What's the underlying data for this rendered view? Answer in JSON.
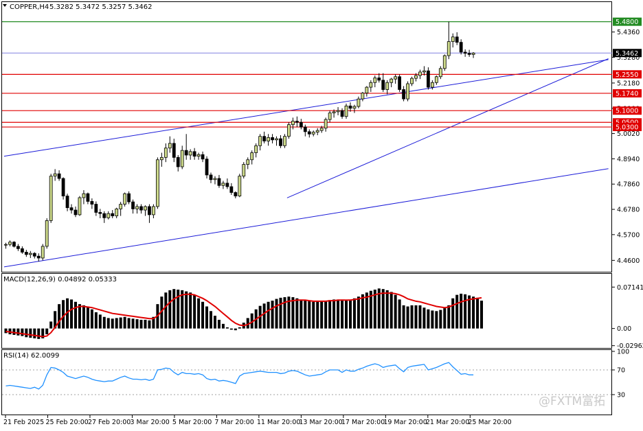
{
  "header": {
    "symbol_label": "COPPER,H4",
    "ohlc_text": "5.3282 5.3472 5.3257 5.3462",
    "menu_triangle": "triangle-down-icon"
  },
  "macd_panel": {
    "label": "MACD(12,26,9) 0.04892 0.05333",
    "scale": [
      "0.07141",
      "0.00",
      "-0.02962"
    ]
  },
  "rsi_panel": {
    "label": "RSI(14) 62.0099",
    "scale": [
      "100",
      "70",
      "30"
    ]
  },
  "watermark": "@FXTM富拓",
  "colors": {
    "bull_candle": "#ccd98a",
    "bear_candle": "#000000",
    "macd_histogram": "#000000",
    "macd_signal": "#e00000",
    "rsi_line": "#1e90ff",
    "support_resistance": "#e00000",
    "high_line": "#228b22",
    "trend_channel": "#1a1ad8",
    "current_price_line": "#8080e0"
  },
  "chart_data": {
    "type": "candlestick",
    "symbol": "COPPER",
    "timeframe": "H4",
    "ylim": [
      4.42,
      5.52
    ],
    "y_ticks": [
      "5.4360",
      "5.3280",
      "5.2180",
      "5.1100",
      "5.0020",
      "4.8940",
      "4.7860",
      "4.6780",
      "4.5700",
      "4.4600"
    ],
    "x_tick_labels": [
      "21 Feb 2025",
      "25 Feb 20:00",
      "27 Feb 20:00",
      "3 Mar 20:00",
      "5 Mar 20:00",
      "7 Mar 20:00",
      "11 Mar 20:00",
      "13 Mar 20:00",
      "17 Mar 20:00",
      "19 Mar 20:00",
      "21 Mar 20:00",
      "25 Mar 20:00"
    ],
    "horizontal_levels": [
      {
        "label": "5.4800",
        "value": 5.48,
        "kind": "high"
      },
      {
        "label": "5.2550",
        "value": 5.255,
        "kind": "level"
      },
      {
        "label": "5.1740",
        "value": 5.174,
        "kind": "level"
      },
      {
        "label": "5.1000",
        "value": 5.1,
        "kind": "level"
      },
      {
        "label": "5.0500",
        "value": 5.05,
        "kind": "level"
      },
      {
        "label": "5.0300",
        "value": 5.03,
        "kind": "level"
      }
    ],
    "current_price": {
      "label": "5.3462",
      "value": 5.3462
    },
    "trendlines": [
      {
        "from": [
          0,
          4.905
        ],
        "to": [
          147,
          5.318
        ]
      },
      {
        "from": [
          0,
          4.432
        ],
        "to": [
          147,
          4.852
        ]
      },
      {
        "from": [
          69,
          4.727
        ],
        "to": [
          147,
          5.322
        ]
      }
    ],
    "candles": [
      [
        4.525,
        4.535,
        4.51,
        4.528
      ],
      [
        4.528,
        4.545,
        4.52,
        4.538
      ],
      [
        4.538,
        4.542,
        4.515,
        4.52
      ],
      [
        4.52,
        4.53,
        4.5,
        4.51
      ],
      [
        4.51,
        4.52,
        4.488,
        4.495
      ],
      [
        4.495,
        4.505,
        4.475,
        4.485
      ],
      [
        4.485,
        4.5,
        4.47,
        4.49
      ],
      [
        4.49,
        4.495,
        4.468,
        4.478
      ],
      [
        4.478,
        4.49,
        4.455,
        4.47
      ],
      [
        4.47,
        4.53,
        4.46,
        4.52
      ],
      [
        4.52,
        4.64,
        4.51,
        4.63
      ],
      [
        4.63,
        4.83,
        4.62,
        4.82
      ],
      [
        4.82,
        4.85,
        4.8,
        4.83
      ],
      [
        4.83,
        4.845,
        4.8,
        4.81
      ],
      [
        4.81,
        4.815,
        4.72,
        4.735
      ],
      [
        4.735,
        4.745,
        4.67,
        4.685
      ],
      [
        4.685,
        4.7,
        4.66,
        4.675
      ],
      [
        4.675,
        4.69,
        4.645,
        4.655
      ],
      [
        4.655,
        4.735,
        4.65,
        4.728
      ],
      [
        4.728,
        4.76,
        4.7,
        4.745
      ],
      [
        4.745,
        4.75,
        4.7,
        4.712
      ],
      [
        4.712,
        4.725,
        4.68,
        4.7
      ],
      [
        4.7,
        4.712,
        4.65,
        4.665
      ],
      [
        4.665,
        4.68,
        4.64,
        4.66
      ],
      [
        4.66,
        4.67,
        4.62,
        4.642
      ],
      [
        4.642,
        4.67,
        4.635,
        4.66
      ],
      [
        4.66,
        4.675,
        4.64,
        4.65
      ],
      [
        4.65,
        4.685,
        4.64,
        4.68
      ],
      [
        4.68,
        4.71,
        4.65,
        4.7
      ],
      [
        4.7,
        4.75,
        4.69,
        4.745
      ],
      [
        4.745,
        4.755,
        4.7,
        4.71
      ],
      [
        4.71,
        4.72,
        4.66,
        4.68
      ],
      [
        4.68,
        4.7,
        4.66,
        4.69
      ],
      [
        4.69,
        4.7,
        4.66,
        4.675
      ],
      [
        4.675,
        4.695,
        4.65,
        4.69
      ],
      [
        4.69,
        4.7,
        4.62,
        4.655
      ],
      [
        4.655,
        4.7,
        4.64,
        4.69
      ],
      [
        4.69,
        4.9,
        4.68,
        4.89
      ],
      [
        4.89,
        4.92,
        4.86,
        4.9
      ],
      [
        4.9,
        4.96,
        4.88,
        4.94
      ],
      [
        4.94,
        4.99,
        4.92,
        4.96
      ],
      [
        4.96,
        4.98,
        4.88,
        4.9
      ],
      [
        4.9,
        4.91,
        4.84,
        4.86
      ],
      [
        4.86,
        4.95,
        4.85,
        4.93
      ],
      [
        4.93,
        5.0,
        4.89,
        4.91
      ],
      [
        4.91,
        4.935,
        4.89,
        4.925
      ],
      [
        4.925,
        4.94,
        4.89,
        4.905
      ],
      [
        4.905,
        4.92,
        4.89,
        4.912
      ],
      [
        4.912,
        4.925,
        4.88,
        4.893
      ],
      [
        4.893,
        4.905,
        4.81,
        4.825
      ],
      [
        4.825,
        4.835,
        4.79,
        4.805
      ],
      [
        4.805,
        4.82,
        4.785,
        4.81
      ],
      [
        4.81,
        4.825,
        4.77,
        4.78
      ],
      [
        4.78,
        4.8,
        4.765,
        4.79
      ],
      [
        4.79,
        4.81,
        4.765,
        4.775
      ],
      [
        4.775,
        4.79,
        4.74,
        4.75
      ],
      [
        4.75,
        4.755,
        4.725,
        4.735
      ],
      [
        4.735,
        4.83,
        4.73,
        4.82
      ],
      [
        4.82,
        4.88,
        4.81,
        4.87
      ],
      [
        4.87,
        4.9,
        4.85,
        4.89
      ],
      [
        4.89,
        4.93,
        4.87,
        4.92
      ],
      [
        4.92,
        4.96,
        4.9,
        4.95
      ],
      [
        4.95,
        5.0,
        4.93,
        4.99
      ],
      [
        4.99,
        5.01,
        4.96,
        4.97
      ],
      [
        4.97,
        5.0,
        4.95,
        4.985
      ],
      [
        4.985,
        5.0,
        4.96,
        4.975
      ],
      [
        4.975,
        4.99,
        4.95,
        4.98
      ],
      [
        4.98,
        4.995,
        4.94,
        4.95
      ],
      [
        4.95,
        5.0,
        4.94,
        4.99
      ],
      [
        4.99,
        5.05,
        4.98,
        5.04
      ],
      [
        5.04,
        5.07,
        5.02,
        5.055
      ],
      [
        5.055,
        5.075,
        5.03,
        5.05
      ],
      [
        5.05,
        5.065,
        5.02,
        5.03
      ],
      [
        5.03,
        5.04,
        4.99,
        5.01
      ],
      [
        5.01,
        5.02,
        4.985,
        5.0
      ],
      [
        5.0,
        5.015,
        4.99,
        5.008
      ],
      [
        5.008,
        5.025,
        4.995,
        5.015
      ],
      [
        5.015,
        5.035,
        5.005,
        5.025
      ],
      [
        5.025,
        5.07,
        5.01,
        5.062
      ],
      [
        5.062,
        5.1,
        5.05,
        5.09
      ],
      [
        5.09,
        5.105,
        5.07,
        5.095
      ],
      [
        5.095,
        5.115,
        5.08,
        5.1
      ],
      [
        5.1,
        5.11,
        5.065,
        5.075
      ],
      [
        5.075,
        5.13,
        5.065,
        5.12
      ],
      [
        5.12,
        5.135,
        5.095,
        5.11
      ],
      [
        5.11,
        5.125,
        5.09,
        5.118
      ],
      [
        5.118,
        5.16,
        5.11,
        5.15
      ],
      [
        5.15,
        5.18,
        5.14,
        5.175
      ],
      [
        5.175,
        5.205,
        5.16,
        5.2
      ],
      [
        5.2,
        5.23,
        5.18,
        5.22
      ],
      [
        5.22,
        5.25,
        5.2,
        5.24
      ],
      [
        5.24,
        5.26,
        5.22,
        5.23
      ],
      [
        5.23,
        5.26,
        5.18,
        5.19
      ],
      [
        5.19,
        5.23,
        5.17,
        5.22
      ],
      [
        5.22,
        5.24,
        5.2,
        5.235
      ],
      [
        5.235,
        5.255,
        5.215,
        5.245
      ],
      [
        5.245,
        5.255,
        5.18,
        5.19
      ],
      [
        5.19,
        5.205,
        5.14,
        5.15
      ],
      [
        5.15,
        5.225,
        5.14,
        5.215
      ],
      [
        5.215,
        5.245,
        5.205,
        5.238
      ],
      [
        5.238,
        5.26,
        5.225,
        5.25
      ],
      [
        5.25,
        5.275,
        5.235,
        5.265
      ],
      [
        5.265,
        5.29,
        5.25,
        5.27
      ],
      [
        5.27,
        5.285,
        5.19,
        5.2
      ],
      [
        5.2,
        5.23,
        5.19,
        5.22
      ],
      [
        5.22,
        5.25,
        5.21,
        5.245
      ],
      [
        5.245,
        5.29,
        5.235,
        5.28
      ],
      [
        5.28,
        5.34,
        5.27,
        5.335
      ],
      [
        5.335,
        5.48,
        5.32,
        5.395
      ],
      [
        5.395,
        5.43,
        5.37,
        5.415
      ],
      [
        5.415,
        5.435,
        5.38,
        5.392
      ],
      [
        5.392,
        5.405,
        5.34,
        5.35
      ],
      [
        5.35,
        5.362,
        5.33,
        5.345
      ],
      [
        5.345,
        5.36,
        5.33,
        5.34
      ],
      [
        5.34,
        5.35,
        5.325,
        5.346
      ]
    ],
    "macd_ylim": [
      -0.03,
      0.0765
    ],
    "macd_histogram": [
      -0.008,
      -0.01,
      -0.011,
      -0.012,
      -0.013,
      -0.015,
      -0.016,
      -0.017,
      -0.018,
      -0.017,
      -0.01,
      0.012,
      0.03,
      0.042,
      0.049,
      0.052,
      0.05,
      0.046,
      0.042,
      0.04,
      0.038,
      0.033,
      0.028,
      0.024,
      0.02,
      0.018,
      0.017,
      0.018,
      0.019,
      0.02,
      0.018,
      0.017,
      0.016,
      0.015,
      0.015,
      0.014,
      0.02,
      0.042,
      0.055,
      0.062,
      0.066,
      0.068,
      0.067,
      0.066,
      0.064,
      0.062,
      0.058,
      0.052,
      0.046,
      0.038,
      0.03,
      0.022,
      0.015,
      0.008,
      0.002,
      -0.002,
      -0.003,
      0.002,
      0.01,
      0.018,
      0.026,
      0.033,
      0.039,
      0.043,
      0.046,
      0.048,
      0.051,
      0.053,
      0.054,
      0.055,
      0.054,
      0.052,
      0.05,
      0.048,
      0.047,
      0.046,
      0.046,
      0.047,
      0.048,
      0.049,
      0.05,
      0.05,
      0.05,
      0.049,
      0.05,
      0.052,
      0.055,
      0.059,
      0.062,
      0.065,
      0.067,
      0.069,
      0.068,
      0.066,
      0.063,
      0.058,
      0.05,
      0.04,
      0.038,
      0.04,
      0.04,
      0.04,
      0.036,
      0.033,
      0.031,
      0.03,
      0.032,
      0.035,
      0.04,
      0.052,
      0.058,
      0.06,
      0.059,
      0.057,
      0.055,
      0.053,
      0.048
    ],
    "macd_signal": [
      -0.005,
      -0.006,
      -0.007,
      -0.008,
      -0.009,
      -0.01,
      -0.011,
      -0.012,
      -0.013,
      -0.014,
      -0.013,
      -0.007,
      0.002,
      0.012,
      0.021,
      0.028,
      0.033,
      0.036,
      0.038,
      0.038,
      0.037,
      0.036,
      0.034,
      0.032,
      0.03,
      0.028,
      0.026,
      0.025,
      0.024,
      0.023,
      0.022,
      0.021,
      0.02,
      0.019,
      0.018,
      0.017,
      0.017,
      0.022,
      0.03,
      0.038,
      0.045,
      0.051,
      0.055,
      0.058,
      0.059,
      0.059,
      0.058,
      0.055,
      0.052,
      0.048,
      0.043,
      0.038,
      0.032,
      0.026,
      0.02,
      0.014,
      0.009,
      0.006,
      0.005,
      0.007,
      0.011,
      0.016,
      0.021,
      0.026,
      0.031,
      0.035,
      0.039,
      0.042,
      0.045,
      0.047,
      0.048,
      0.049,
      0.049,
      0.049,
      0.048,
      0.047,
      0.047,
      0.047,
      0.047,
      0.048,
      0.048,
      0.049,
      0.049,
      0.049,
      0.049,
      0.05,
      0.051,
      0.053,
      0.054,
      0.056,
      0.058,
      0.06,
      0.061,
      0.061,
      0.061,
      0.06,
      0.058,
      0.055,
      0.051,
      0.049,
      0.047,
      0.046,
      0.044,
      0.042,
      0.04,
      0.038,
      0.037,
      0.036,
      0.037,
      0.04,
      0.043,
      0.046,
      0.048,
      0.05,
      0.051,
      0.052,
      0.053
    ],
    "rsi_ylim": [
      0,
      100
    ],
    "rsi": [
      44,
      45,
      44,
      43,
      42,
      41,
      40,
      42,
      39,
      45,
      62,
      74,
      73,
      70,
      66,
      60,
      58,
      56,
      58,
      60,
      58,
      55,
      53,
      52,
      51,
      52,
      52,
      55,
      58,
      60,
      57,
      55,
      55,
      54,
      55,
      53,
      55,
      70,
      71,
      73,
      72,
      66,
      62,
      66,
      64,
      64,
      63,
      64,
      62,
      56,
      54,
      55,
      52,
      53,
      52,
      50,
      48,
      60,
      64,
      65,
      66,
      67,
      68,
      67,
      66,
      66,
      66,
      64,
      65,
      68,
      69,
      68,
      65,
      62,
      60,
      61,
      62,
      63,
      67,
      70,
      70,
      70,
      66,
      70,
      68,
      68,
      71,
      73,
      76,
      78,
      80,
      78,
      74,
      76,
      77,
      78,
      72,
      67,
      74,
      76,
      77,
      78,
      79,
      70,
      72,
      74,
      77,
      80,
      82,
      75,
      69,
      63,
      64,
      62,
      62
    ]
  }
}
